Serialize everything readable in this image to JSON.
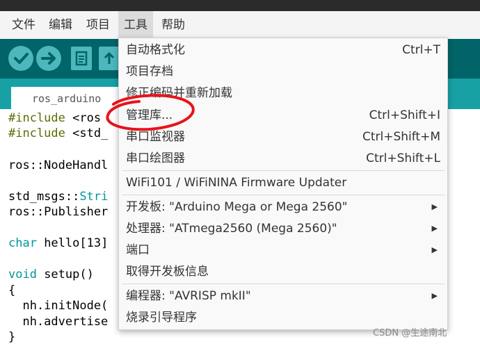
{
  "menubar": {
    "items": [
      "文件",
      "编辑",
      "项目",
      "工具",
      "帮助"
    ]
  },
  "tab": {
    "label": "ros_arduino"
  },
  "code": {
    "include_kw": "#include",
    "line1_rest": " <ros",
    "line2_rest": " <std_",
    "line3": "ros::NodeHandl",
    "line4_ns": "std_msgs::",
    "line4_type": "Stri",
    "line5": "ros::Publisher",
    "line6_type": "char",
    "line6_rest": " hello[13]",
    "line7_type": "void",
    "line7_fn": " setup()",
    "line8": "{",
    "line9": "  nh.initNode(",
    "line10": "  nh.advertise",
    "line11": "}"
  },
  "tools_menu": {
    "items": [
      {
        "label": "自动格式化",
        "shortcut": "Ctrl+T"
      },
      {
        "label": "项目存档",
        "shortcut": ""
      },
      {
        "label": "修正编码并重新加载",
        "shortcut": ""
      },
      {
        "label": "管理库...",
        "shortcut": "Ctrl+Shift+I"
      },
      {
        "label": "串口监视器",
        "shortcut": "Ctrl+Shift+M"
      },
      {
        "label": "串口绘图器",
        "shortcut": "Ctrl+Shift+L"
      },
      {
        "label": "WiFi101 / WiFiNINA Firmware Updater",
        "shortcut": ""
      },
      {
        "label": "开发板: \"Arduino Mega or Mega 2560\"",
        "shortcut": ""
      },
      {
        "label": "处理器: \"ATmega2560 (Mega 2560)\"",
        "shortcut": ""
      },
      {
        "label": "端口",
        "shortcut": ""
      },
      {
        "label": "取得开发板信息",
        "shortcut": ""
      },
      {
        "label": "编程器: \"AVRISP mkII\"",
        "shortcut": ""
      },
      {
        "label": "烧录引导程序",
        "shortcut": ""
      }
    ],
    "submenu_arrow": "▶"
  },
  "annotation": {
    "color": "#e8131a"
  },
  "watermark": "CSDN @生途南北",
  "colors": {
    "toolbar": "#006468",
    "tabstrip": "#17a1a5",
    "button": "#4db7bb"
  }
}
